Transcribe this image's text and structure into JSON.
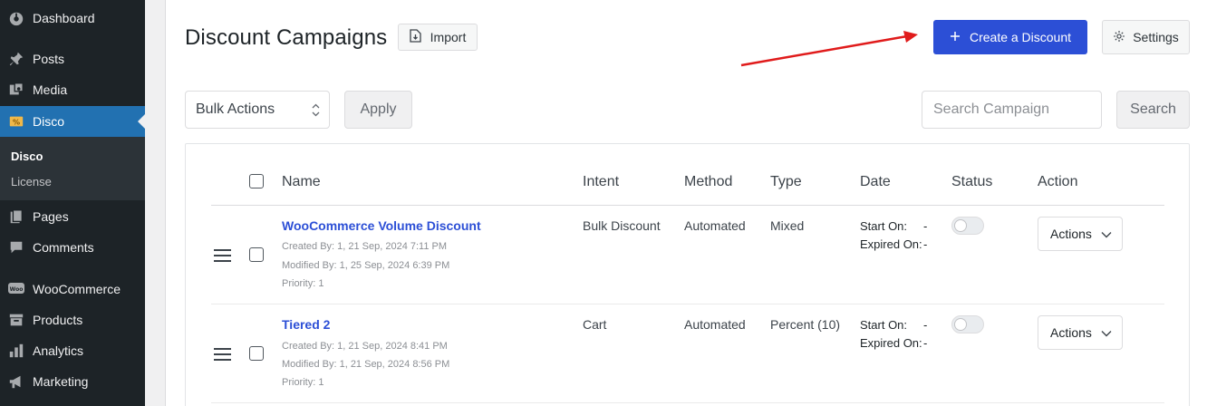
{
  "sidebar": {
    "items": [
      {
        "label": "Dashboard",
        "icon": "dashboard-icon"
      },
      {
        "label": "Posts",
        "icon": "pin-icon"
      },
      {
        "label": "Media",
        "icon": "media-icon"
      },
      {
        "label": "Disco",
        "icon": "ticket-icon"
      },
      {
        "label": "Pages",
        "icon": "pages-icon"
      },
      {
        "label": "Comments",
        "icon": "comment-icon"
      },
      {
        "label": "WooCommerce",
        "icon": "woo-icon"
      },
      {
        "label": "Products",
        "icon": "archive-icon"
      },
      {
        "label": "Analytics",
        "icon": "chart-bar-icon"
      },
      {
        "label": "Marketing",
        "icon": "megaphone-icon"
      }
    ],
    "submenu": [
      {
        "label": "Disco"
      },
      {
        "label": "License"
      }
    ],
    "colors": {
      "bg": "#1d2327",
      "active": "#2271b1"
    }
  },
  "header": {
    "title": "Discount Campaigns",
    "import_label": "Import",
    "create_label": "Create a Discount",
    "settings_label": "Settings"
  },
  "toolbar": {
    "bulk_actions": "Bulk Actions",
    "apply_label": "Apply",
    "search_placeholder": "Search Campaign",
    "search_label": "Search"
  },
  "table": {
    "columns": {
      "name": "Name",
      "intent": "Intent",
      "method": "Method",
      "type": "Type",
      "date": "Date",
      "status": "Status",
      "action": "Action"
    },
    "rows": [
      {
        "name": "WooCommerce Volume Discount",
        "created": "Created By: 1, 21 Sep, 2024 7:11 PM",
        "modified": "Modified By: 1, 25 Sep, 2024 6:39 PM",
        "priority": "Priority: 1",
        "intent": "Bulk Discount",
        "method": "Automated",
        "type": "Mixed",
        "start_label": "Start On:",
        "start_value": "-",
        "expired_label": "Expired On:",
        "expired_value": "-",
        "status_enabled": false,
        "actions_label": "Actions"
      },
      {
        "name": "Tiered 2",
        "created": "Created By: 1, 21 Sep, 2024 8:41 PM",
        "modified": "Modified By: 1, 21 Sep, 2024 8:56 PM",
        "priority": "Priority: 1",
        "intent": "Cart",
        "method": "Automated",
        "type": "Percent (10)",
        "start_label": "Start On:",
        "start_value": "-",
        "expired_label": "Expired On:",
        "expired_value": "-",
        "status_enabled": false,
        "actions_label": "Actions"
      }
    ]
  },
  "colors": {
    "primary": "#2c4fd6",
    "arrow": "#e01b1b"
  }
}
